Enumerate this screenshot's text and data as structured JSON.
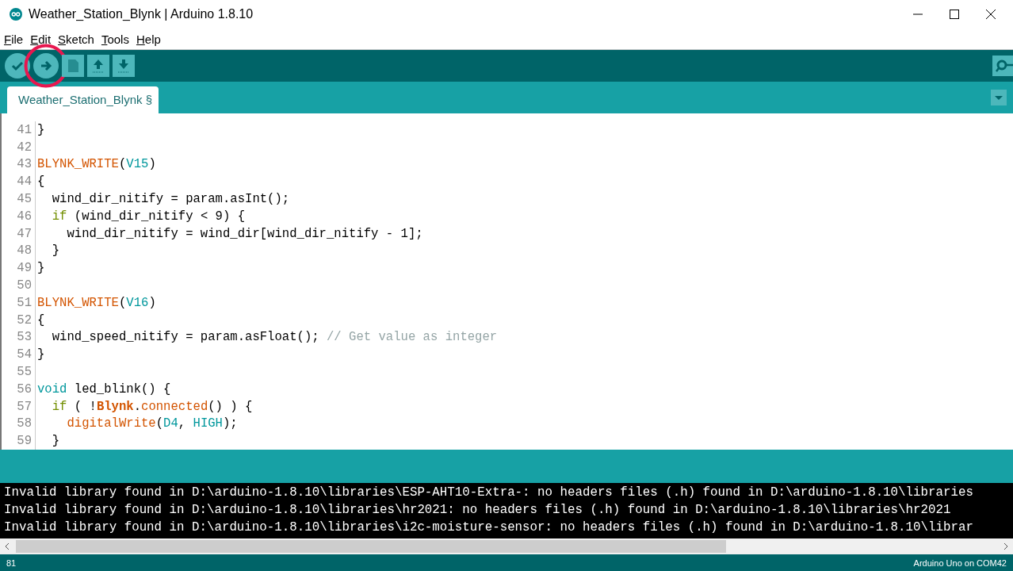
{
  "window": {
    "title": "Weather_Station_Blynk | Arduino 1.8.10"
  },
  "menu": [
    {
      "label": "File"
    },
    {
      "label": "Edit"
    },
    {
      "label": "Sketch"
    },
    {
      "label": "Tools"
    },
    {
      "label": "Help"
    }
  ],
  "toolbar": [
    {
      "kind": "verify",
      "highlighted": false
    },
    {
      "kind": "upload",
      "highlighted": true
    },
    {
      "kind": "new",
      "highlighted": false
    },
    {
      "kind": "open",
      "highlighted": false
    },
    {
      "kind": "save",
      "highlighted": false
    }
  ],
  "tabs": [
    {
      "label": "Weather_Station_Blynk §",
      "selected": true
    }
  ],
  "editor": {
    "lines": [
      {
        "number": "41",
        "tokens": [
          {
            "kind": "plain",
            "text": "}"
          }
        ]
      },
      {
        "number": "42"
      },
      {
        "number": "43",
        "tokens": [
          {
            "kind": "func",
            "text": "BLYNK_WRITE"
          },
          {
            "kind": "plain",
            "text": "("
          },
          {
            "kind": "const",
            "text": "V15"
          },
          {
            "kind": "plain",
            "text": ")"
          }
        ]
      },
      {
        "number": "44",
        "tokens": [
          {
            "kind": "plain",
            "text": "{"
          }
        ]
      },
      {
        "number": "45",
        "tokens": [
          {
            "kind": "plain",
            "text": "  wind_dir_nitify = param.asInt();"
          }
        ]
      },
      {
        "number": "46",
        "tokens": [
          {
            "kind": "control",
            "text": "  if"
          },
          {
            "kind": "plain",
            "text": " (wind_dir_nitify < 9) {"
          }
        ]
      },
      {
        "number": "47",
        "tokens": [
          {
            "kind": "plain",
            "text": "    wind_dir_nitify = wind_dir[wind_dir_nitify - 1];"
          }
        ]
      },
      {
        "number": "48",
        "tokens": [
          {
            "kind": "plain",
            "text": "  }"
          }
        ]
      },
      {
        "number": "49",
        "tokens": [
          {
            "kind": "plain",
            "text": "}"
          }
        ]
      },
      {
        "number": "50"
      },
      {
        "number": "51",
        "tokens": [
          {
            "kind": "func",
            "text": "BLYNK_WRITE"
          },
          {
            "kind": "plain",
            "text": "("
          },
          {
            "kind": "const",
            "text": "V16"
          },
          {
            "kind": "plain",
            "text": ")"
          }
        ]
      },
      {
        "number": "52",
        "tokens": [
          {
            "kind": "plain",
            "text": "{"
          }
        ]
      },
      {
        "number": "53",
        "tokens": [
          {
            "kind": "plain",
            "text": "  wind_speed_nitify = param.asFloat(); "
          },
          {
            "kind": "comment",
            "text": "// Get value as integer"
          }
        ]
      },
      {
        "number": "54",
        "tokens": [
          {
            "kind": "plain",
            "text": "}"
          }
        ]
      },
      {
        "number": "55"
      },
      {
        "number": "56",
        "tokens": [
          {
            "kind": "type",
            "text": "void"
          },
          {
            "kind": "plain",
            "text": " led_blink() {"
          }
        ]
      },
      {
        "number": "57",
        "tokens": [
          {
            "kind": "control",
            "text": "  if"
          },
          {
            "kind": "plain",
            "text": " ( !"
          },
          {
            "kind": "class",
            "text": "Blynk"
          },
          {
            "kind": "plain",
            "text": "."
          },
          {
            "kind": "func",
            "text": "connected"
          },
          {
            "kind": "plain",
            "text": "() ) {"
          }
        ]
      },
      {
        "number": "58",
        "tokens": [
          {
            "kind": "func",
            "text": "    digitalWrite"
          },
          {
            "kind": "plain",
            "text": "("
          },
          {
            "kind": "const",
            "text": "D4"
          },
          {
            "kind": "plain",
            "text": ", "
          },
          {
            "kind": "const",
            "text": "HIGH"
          },
          {
            "kind": "plain",
            "text": ");"
          }
        ]
      },
      {
        "number": "59",
        "tokens": [
          {
            "kind": "plain",
            "text": "  }"
          }
        ]
      }
    ]
  },
  "console": {
    "lines": [
      "Invalid library found in D:\\arduino-1.8.10\\libraries\\ESP-AHT10-Extra-: no headers files (.h) found in D:\\arduino-1.8.10\\libraries",
      "Invalid library found in D:\\arduino-1.8.10\\libraries\\hr2021: no headers files (.h) found in D:\\arduino-1.8.10\\libraries\\hr2021",
      "Invalid library found in D:\\arduino-1.8.10\\libraries\\i2c-moisture-sensor: no headers files (.h) found in D:\\arduino-1.8.10\\librar"
    ]
  },
  "status_bar": {
    "line": "81",
    "board": "Arduino Uno on COM42"
  }
}
